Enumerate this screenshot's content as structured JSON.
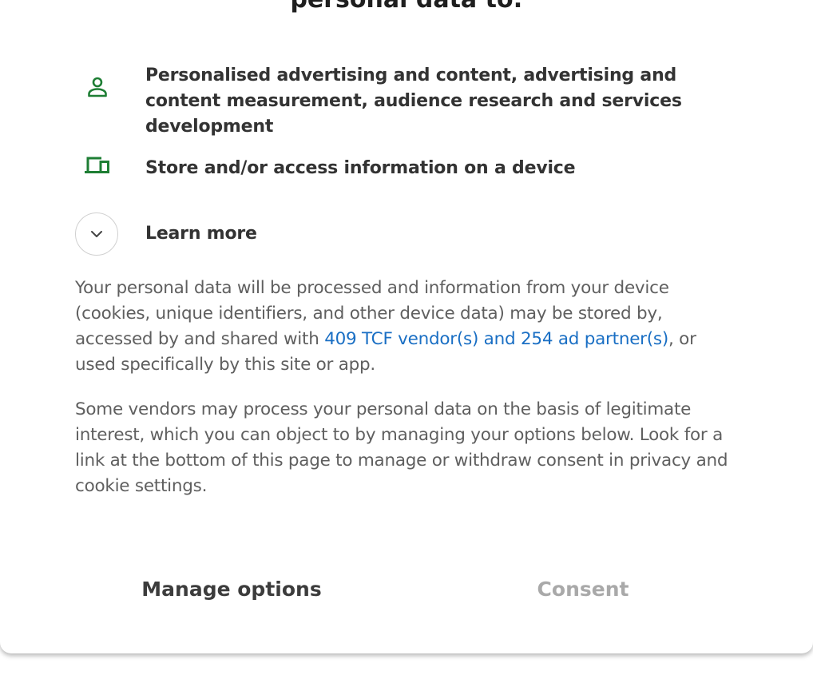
{
  "dialog": {
    "heading": "personal data to:",
    "purposes": [
      {
        "icon": "person-icon",
        "label": "Personalised advertising and content, advertising and content measurement, audience research and services development"
      },
      {
        "icon": "devices-icon",
        "label": "Store and/or access information on a device"
      }
    ],
    "learn_more": "Learn more",
    "paragraph1": {
      "before": "Your personal data will be processed and information from your device (cookies, unique identifiers, and other device data) may be stored by, accessed by and shared with ",
      "link": "409 TCF vendor(s) and 254 ad partner(s)",
      "after": ", or used specifically by this site or app."
    },
    "paragraph2": "Some vendors may process your personal data on the basis of legitimate interest, which you can object to by managing your options below. Look for a link at the bottom of this page to manage or withdraw consent in privacy and cookie settings.",
    "buttons": {
      "manage": "Manage options",
      "consent": "Consent"
    }
  },
  "colors": {
    "icon_green": "#1e7e34",
    "link_blue": "#1a6fc4",
    "consent_disabled": "#a9a9a9"
  }
}
